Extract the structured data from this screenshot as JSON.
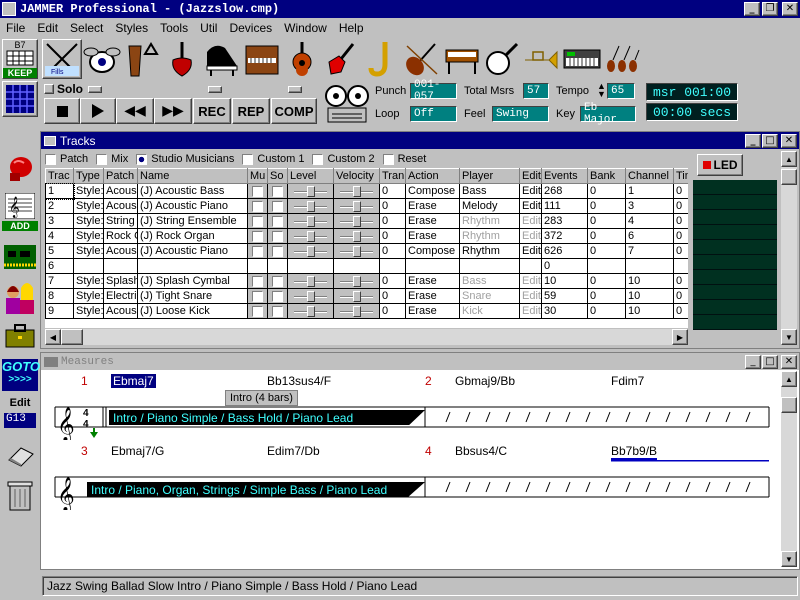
{
  "window": {
    "title": "JAMMER Professional - (Jazzslow.cmp)"
  },
  "menu": [
    "File",
    "Edit",
    "Select",
    "Styles",
    "Tools",
    "Util",
    "Devices",
    "Window",
    "Help"
  ],
  "toolbar": {
    "b7": "B7",
    "keep": "KEEP",
    "add": "ADD",
    "goto": "GOTO",
    "goto_arrows": ">>>>",
    "edit": "Edit",
    "edit_value": "G13"
  },
  "instruments": [
    "drum-kit-icon",
    "conga-icon",
    "triangle-icon",
    "bass-guitar-icon",
    "grand-piano-icon",
    "organ-icon",
    "acoustic-guitar-icon",
    "electric-guitar-icon",
    "saxophone-icon",
    "violin-icon",
    "harpsichord-icon",
    "banjo-icon",
    "trumpet-icon",
    "synthesizer-icon",
    "strings-section-icon"
  ],
  "transport": {
    "solo": "Solo",
    "rec": "REC",
    "rep": "REP",
    "comp": "COMP"
  },
  "info": {
    "punch_label": "Punch",
    "punch_value": "001-057",
    "total_label": "Total Msrs",
    "total_value": "57",
    "tempo_label": "Tempo",
    "tempo_value": "65",
    "loop_label": "Loop",
    "loop_value": "Off",
    "feel_label": "Feel",
    "feel_value": "Swing",
    "key_label": "Key",
    "key_value": "Eb Major",
    "msr_display": "msr 001:00",
    "secs_display": "00:00 secs"
  },
  "tracks_window": {
    "title": "Tracks",
    "options": [
      "Patch",
      "Mix",
      "Studio Musicians",
      "Custom 1",
      "Custom 2",
      "Reset"
    ],
    "checked_option": 2,
    "led": "LED",
    "columns": [
      "Trac",
      "Type",
      "Patch",
      "Name",
      "Mu",
      "So",
      "Level",
      "Velocity",
      "Tran",
      "Action",
      "Player",
      "Edit",
      "Events",
      "Bank",
      "Channel",
      "Tim"
    ],
    "rows": [
      {
        "trac": "1",
        "type": "Style:",
        "patch": "Acous",
        "name": "(J) Acoustic Bass",
        "tran": "0",
        "action": "Compose",
        "player": "Bass",
        "edit": "Edit",
        "events": "268",
        "bank": "0",
        "channel": "1",
        "tim": "0",
        "dim": false
      },
      {
        "trac": "2",
        "type": "Style:",
        "patch": "Acous",
        "name": "(J) Acoustic Piano",
        "tran": "0",
        "action": "Erase",
        "player": "Melody",
        "edit": "Edit",
        "events": "111",
        "bank": "0",
        "channel": "3",
        "tim": "0",
        "dim": false
      },
      {
        "trac": "3",
        "type": "Style:",
        "patch": "String",
        "name": "(J) String Ensemble",
        "tran": "0",
        "action": "Erase",
        "player": "Rhythm",
        "edit": "Edit",
        "events": "283",
        "bank": "0",
        "channel": "4",
        "tim": "0",
        "dim": true
      },
      {
        "trac": "4",
        "type": "Style:",
        "patch": "Rock O",
        "name": "(J) Rock Organ",
        "tran": "0",
        "action": "Erase",
        "player": "Rhythm",
        "edit": "Edit",
        "events": "372",
        "bank": "0",
        "channel": "6",
        "tim": "0",
        "dim": true
      },
      {
        "trac": "5",
        "type": "Style:",
        "patch": "Acous",
        "name": "(J) Acoustic Piano",
        "tran": "0",
        "action": "Compose",
        "player": "Rhythm",
        "edit": "Edit",
        "events": "626",
        "bank": "0",
        "channel": "7",
        "tim": "0",
        "dim": false
      },
      {
        "trac": "6",
        "type": "",
        "patch": "",
        "name": "",
        "tran": "",
        "action": "",
        "player": "",
        "edit": "",
        "events": "0",
        "bank": "",
        "channel": "",
        "tim": "",
        "dim": false,
        "empty": true
      },
      {
        "trac": "7",
        "type": "Style:",
        "patch": "Splash",
        "name": "(J) Splash Cymbal",
        "tran": "0",
        "action": "Erase",
        "player": "Bass",
        "edit": "Edit",
        "events": "10",
        "bank": "0",
        "channel": "10",
        "tim": "0",
        "dim": true
      },
      {
        "trac": "8",
        "type": "Style:",
        "patch": "Electri",
        "name": "(J) Tight Snare",
        "tran": "0",
        "action": "Erase",
        "player": "Snare",
        "edit": "Edit",
        "events": "59",
        "bank": "0",
        "channel": "10",
        "tim": "0",
        "dim": true
      },
      {
        "trac": "9",
        "type": "Style:",
        "patch": "Acous",
        "name": "(J) Loose Kick",
        "tran": "0",
        "action": "Erase",
        "player": "Kick",
        "edit": "Edit",
        "events": "30",
        "bank": "0",
        "channel": "10",
        "tim": "0",
        "dim": true
      }
    ]
  },
  "measures_window": {
    "title": "Measures",
    "row1": {
      "m1": "1",
      "m2": "2",
      "chords": [
        "Ebmaj7",
        "Bb13sus4/F",
        "Gbmaj9/Bb",
        "Fdim7"
      ],
      "intro": "Intro (4 bars)",
      "label": "Intro / Piano Simple / Bass Hold / Piano Lead"
    },
    "row2": {
      "m1": "3",
      "m2": "4",
      "chords": [
        "Ebmaj7/G",
        "Edim7/Db",
        "Bbsus4/C",
        "Bb7b9/B"
      ],
      "label": "Intro / Piano, Organ, Strings / Simple Bass / Piano Lead"
    }
  },
  "status": "Jazz Swing Ballad Slow Intro / Piano Simple / Bass Hold / Piano Lead",
  "colors": {
    "title_blue": "#000080",
    "lcd_teal": "#008080",
    "accent_cyan": "#40ffff",
    "measure_red": "#c00000"
  }
}
